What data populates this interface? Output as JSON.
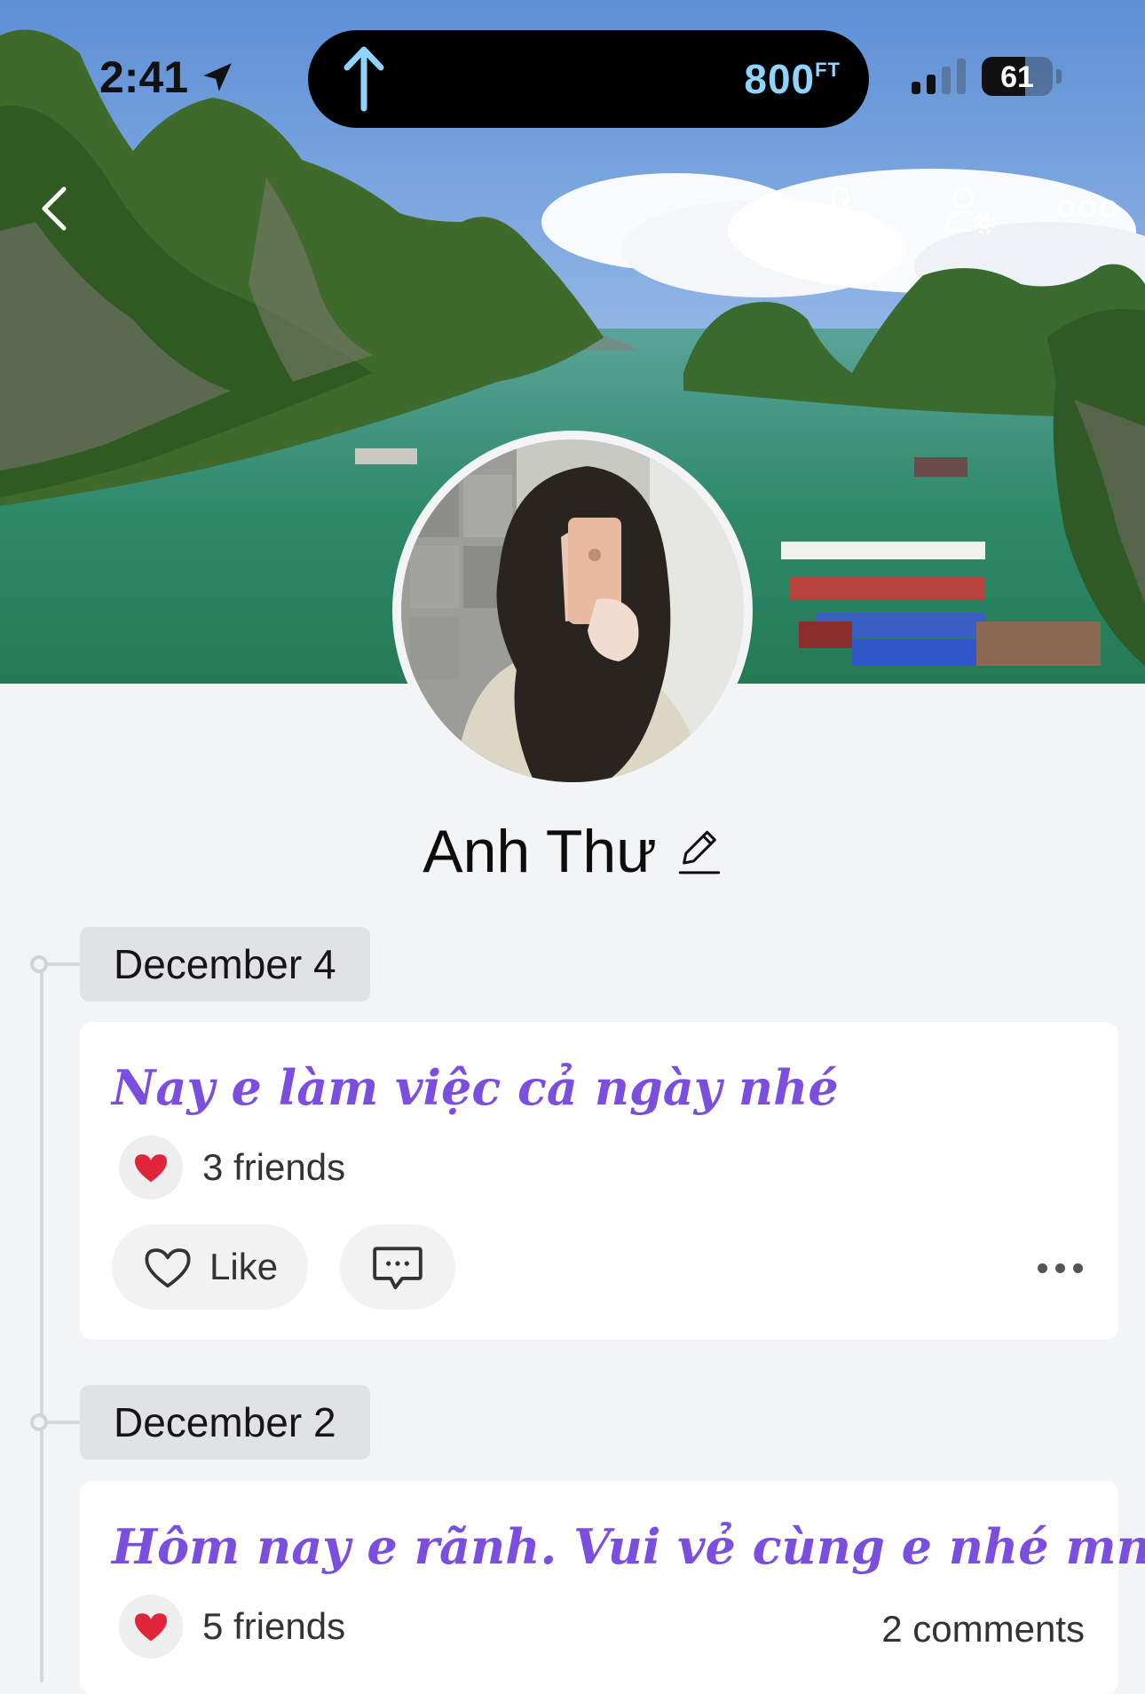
{
  "status_bar": {
    "time": "2:41",
    "altitude": "800",
    "altitude_unit": "FT",
    "battery": "61",
    "battery_level": 0.61
  },
  "profile": {
    "name": "Anh Thư"
  },
  "timeline": [
    {
      "date": "December 4",
      "text": "Nay e làm việc cả ngày nhé",
      "reactions": "3 friends",
      "comments": "",
      "like_label": "Like"
    },
    {
      "date": "December 2",
      "text": "Hôm nay e rãnh. Vui vẻ cùng e nhé mn",
      "reactions": "5 friends",
      "comments": "2 comments"
    }
  ],
  "colors": {
    "post_text": "#7a4fe0",
    "heart": "#e0243a",
    "background": "#f3f4f6"
  }
}
